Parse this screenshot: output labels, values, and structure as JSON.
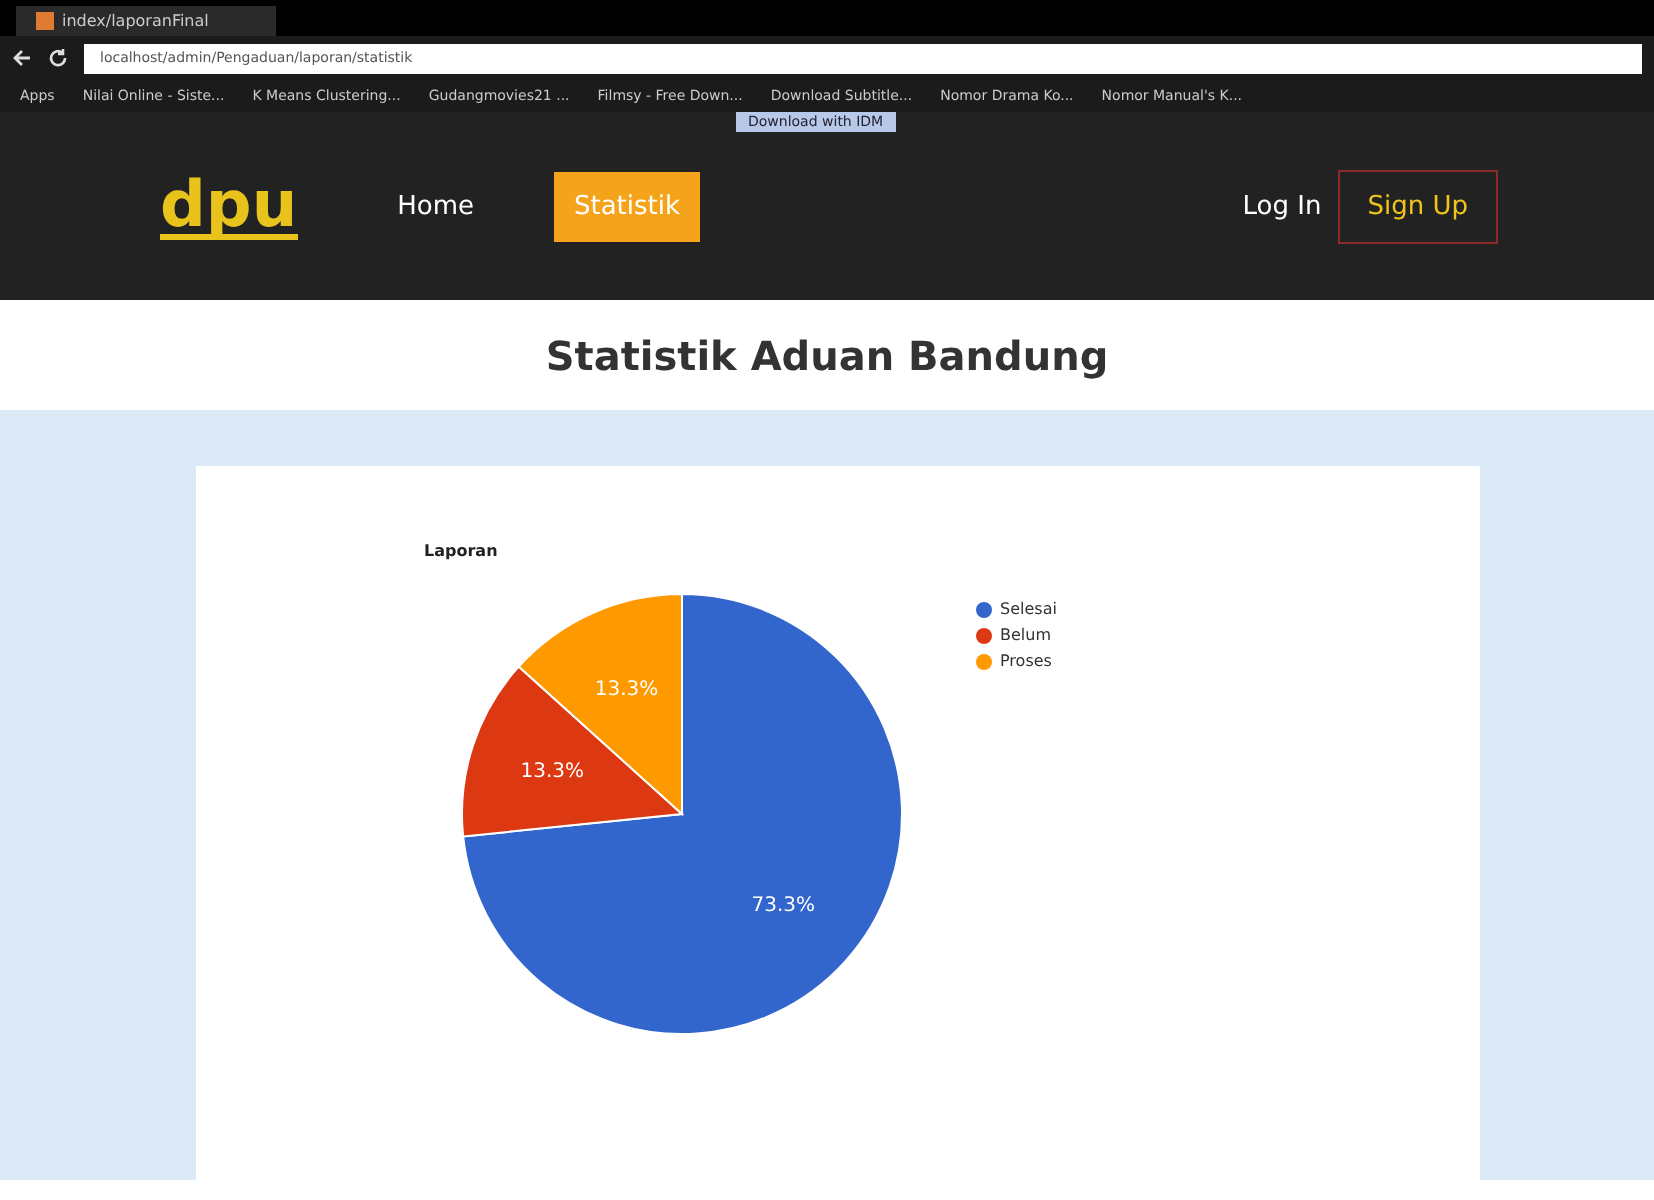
{
  "browser": {
    "tab_title": "index/laporanFinal",
    "url": "localhost/admin/Pengaduan/laporan/statistik",
    "bookmarks": [
      "Apps",
      "Nilai Online - Siste...",
      "K Means Clustering...",
      "Gudangmovies21 ...",
      "Filmsy - Free Down...",
      "Download Subtitle...",
      "Nomor Drama Ko...",
      "Nomor Manual's K..."
    ],
    "download_popup": "Download with IDM"
  },
  "navbar": {
    "logo": "dpu",
    "links": [
      {
        "label": "Home",
        "selected": false
      },
      {
        "label": "Statistik",
        "selected": true
      }
    ],
    "login": "Log In",
    "signup": "Sign Up"
  },
  "page_title": "Statistik Aduan Bandung",
  "chart_data": {
    "type": "pie",
    "title": "Laporan",
    "categories": [
      "Selesai",
      "Belum",
      "Proses"
    ],
    "values": [
      73.3,
      13.3,
      13.3
    ],
    "legend": "right",
    "colors": [
      "#3366cc",
      "#dc3912",
      "#ff9900"
    ],
    "value_labels": [
      "73.3%",
      "13.3%",
      "13.3%"
    ]
  }
}
